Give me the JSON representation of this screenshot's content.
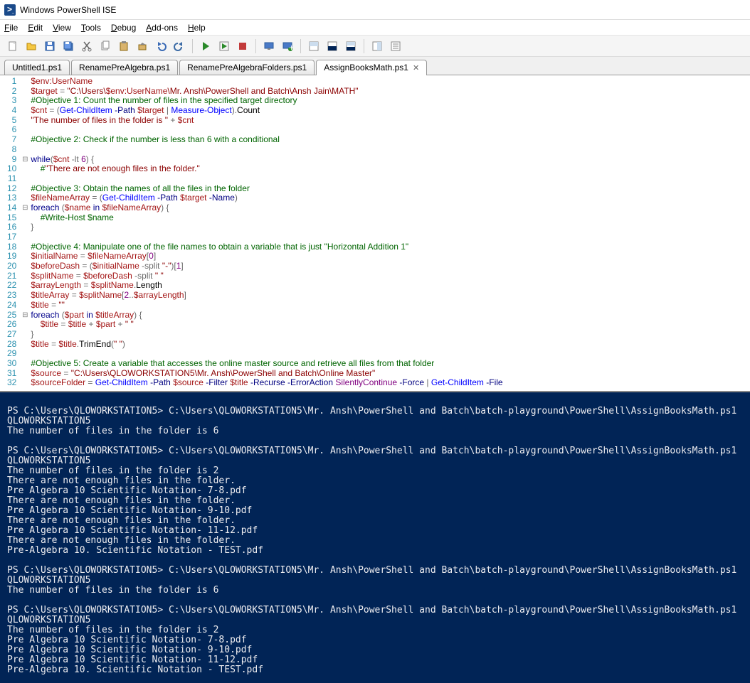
{
  "window": {
    "title": "Windows PowerShell ISE"
  },
  "menu": {
    "file": "File",
    "edit": "Edit",
    "view": "View",
    "tools": "Tools",
    "debug": "Debug",
    "addons": "Add-ons",
    "help": "Help"
  },
  "tabs": [
    {
      "label": "Untitled1.ps1",
      "active": false
    },
    {
      "label": "RenamePreAlgebra.ps1",
      "active": false
    },
    {
      "label": "RenamePreAlgebraFolders.ps1",
      "active": false
    },
    {
      "label": "AssignBooksMath.ps1",
      "active": true
    }
  ],
  "code": {
    "lines": [
      {
        "n": 1,
        "f": "",
        "h": "<span class='c-var'>$env:UserName</span>"
      },
      {
        "n": 2,
        "f": "",
        "h": "<span class='c-var'>$target</span> <span class='c-op'>=</span> <span class='c-str'>\"C:\\Users\\</span><span class='c-var'>$env:UserName</span><span class='c-str'>\\Mr. Ansh\\PowerShell and Batch\\Ansh Jain\\MATH\"</span>"
      },
      {
        "n": 3,
        "f": "",
        "h": "<span class='c-cmt'>#Objective 1: Count the number of files in the specified target directory</span>"
      },
      {
        "n": 4,
        "f": "",
        "h": "<span class='c-var'>$cnt</span> <span class='c-op'>=</span> <span class='c-op'>(</span><span class='c-cmd'>Get-ChildItem</span> <span class='c-param'>-Path</span> <span class='c-var'>$target</span> <span class='c-op'>|</span> <span class='c-cmd'>Measure-Object</span><span class='c-op'>).</span><span class='c-txt'>Count</span>"
      },
      {
        "n": 5,
        "f": "",
        "h": "<span class='c-str'>\"The number of files in the folder is \"</span> <span class='c-op'>+</span> <span class='c-var'>$cnt</span>"
      },
      {
        "n": 6,
        "f": "",
        "h": ""
      },
      {
        "n": 7,
        "f": "",
        "h": "<span class='c-cmt'>#Objective 2: Check if the number is less than 6 with a conditional</span>"
      },
      {
        "n": 8,
        "f": "",
        "h": ""
      },
      {
        "n": 9,
        "f": "⊟",
        "h": "<span class='c-kw'>while</span><span class='c-op'>(</span><span class='c-var'>$cnt</span> <span class='c-op'>-lt</span> <span class='c-num'>6</span><span class='c-op'>) {</span>"
      },
      {
        "n": 10,
        "f": "",
        "h": "    <span class='c-cmt'>#</span><span class='c-str'>\"There are not enough files in the folder.\"</span>"
      },
      {
        "n": 11,
        "f": "",
        "h": ""
      },
      {
        "n": 12,
        "f": "",
        "h": "<span class='c-cmt'>#Objective 3: Obtain the names of all the files in the folder</span>"
      },
      {
        "n": 13,
        "f": "",
        "h": "<span class='c-var'>$fileNameArray</span> <span class='c-op'>= (</span><span class='c-cmd'>Get-ChildItem</span> <span class='c-param'>-Path</span> <span class='c-var'>$target</span> <span class='c-param'>-Name</span><span class='c-op'>)</span>"
      },
      {
        "n": 14,
        "f": "⊟",
        "h": "<span class='c-kw'>foreach</span> <span class='c-op'>(</span><span class='c-var'>$name</span> <span class='c-kw'>in</span> <span class='c-var'>$fileNameArray</span><span class='c-op'>) {</span>"
      },
      {
        "n": 15,
        "f": "",
        "h": "    <span class='c-cmt'>#Write-Host $name</span>"
      },
      {
        "n": 16,
        "f": "",
        "h": "<span class='c-op'>}</span>"
      },
      {
        "n": 17,
        "f": "",
        "h": ""
      },
      {
        "n": 18,
        "f": "",
        "h": "<span class='c-cmt'>#Objective 4: Manipulate one of the file names to obtain a variable that is just \"Horizontal Addition 1\"</span>"
      },
      {
        "n": 19,
        "f": "",
        "h": "<span class='c-var'>$initialName</span> <span class='c-op'>=</span> <span class='c-var'>$fileNameArray</span><span class='c-op'>[</span><span class='c-num'>0</span><span class='c-op'>]</span>"
      },
      {
        "n": 20,
        "f": "",
        "h": "<span class='c-var'>$beforeDash</span> <span class='c-op'>= (</span><span class='c-var'>$initialName</span> <span class='c-op'>-split</span> <span class='c-str'>\"-\"</span><span class='c-op'>)[</span><span class='c-num'>1</span><span class='c-op'>]</span>"
      },
      {
        "n": 21,
        "f": "",
        "h": "<span class='c-var'>$splitName</span> <span class='c-op'>=</span> <span class='c-var'>$beforeDash</span> <span class='c-op'>-split</span> <span class='c-str'>\" \"</span>"
      },
      {
        "n": 22,
        "f": "",
        "h": "<span class='c-var'>$arrayLength</span> <span class='c-op'>=</span> <span class='c-var'>$splitName</span><span class='c-op'>.</span><span class='c-txt'>Length</span>"
      },
      {
        "n": 23,
        "f": "",
        "h": "<span class='c-var'>$titleArray</span> <span class='c-op'>=</span> <span class='c-var'>$splitName</span><span class='c-op'>[</span><span class='c-num'>2</span><span class='c-op'>..</span><span class='c-var'>$arrayLength</span><span class='c-op'>]</span>"
      },
      {
        "n": 24,
        "f": "",
        "h": "<span class='c-var'>$title</span> <span class='c-op'>=</span> <span class='c-str'>\"\"</span>"
      },
      {
        "n": 25,
        "f": "⊟",
        "h": "<span class='c-kw'>foreach</span> <span class='c-op'>(</span><span class='c-var'>$part</span> <span class='c-kw'>in</span> <span class='c-var'>$titleArray</span><span class='c-op'>) {</span>"
      },
      {
        "n": 26,
        "f": "",
        "h": "    <span class='c-var'>$title</span> <span class='c-op'>=</span> <span class='c-var'>$title</span> <span class='c-op'>+</span> <span class='c-var'>$part</span> <span class='c-op'>+</span> <span class='c-str'>\" \"</span>"
      },
      {
        "n": 27,
        "f": "",
        "h": "<span class='c-op'>}</span>"
      },
      {
        "n": 28,
        "f": "",
        "h": "<span class='c-var'>$title</span> <span class='c-op'>=</span> <span class='c-var'>$title</span><span class='c-op'>.</span><span class='c-txt'>TrimEnd</span><span class='c-op'>(</span><span class='c-str'>\" \"</span><span class='c-op'>)</span>"
      },
      {
        "n": 29,
        "f": "",
        "h": ""
      },
      {
        "n": 30,
        "f": "",
        "h": "<span class='c-cmt'>#Objective 5: Create a variable that accesses the online master source and retrieve all files from that folder</span>"
      },
      {
        "n": 31,
        "f": "",
        "h": "<span class='c-var'>$source</span> <span class='c-op'>=</span> <span class='c-str'>\"C:\\Users\\QLOWORKSTATION5\\Mr. Ansh\\PowerShell and Batch\\Online Master\"</span>"
      },
      {
        "n": 32,
        "f": "",
        "h": "<span class='c-var'>$sourceFolder</span> <span class='c-op'>=</span> <span class='c-cmd'>Get-ChildItem</span> <span class='c-param'>-Path</span> <span class='c-var'>$source</span> <span class='c-param'>-Filter</span> <span class='c-var'>$title</span> <span class='c-param'>-Recurse</span> <span class='c-param'>-ErrorAction</span> <span class='c-num'>SilentlyContinue</span> <span class='c-param'>-Force</span> <span class='c-op'>|</span> <span class='c-cmd'>Get-ChildItem</span> <span class='c-param'>-File</span>"
      }
    ]
  },
  "console_lines": [
    "",
    "PS C:\\Users\\QLOWORKSTATION5> C:\\Users\\QLOWORKSTATION5\\Mr. Ansh\\PowerShell and Batch\\batch-playground\\PowerShell\\AssignBooksMath.ps1",
    "QLOWORKSTATION5",
    "The number of files in the folder is 6",
    "",
    "PS C:\\Users\\QLOWORKSTATION5> C:\\Users\\QLOWORKSTATION5\\Mr. Ansh\\PowerShell and Batch\\batch-playground\\PowerShell\\AssignBooksMath.ps1",
    "QLOWORKSTATION5",
    "The number of files in the folder is 2",
    "There are not enough files in the folder.",
    "Pre Algebra 10 Scientific Notation- 7-8.pdf",
    "There are not enough files in the folder.",
    "Pre Algebra 10 Scientific Notation- 9-10.pdf",
    "There are not enough files in the folder.",
    "Pre Algebra 10 Scientific Notation- 11-12.pdf",
    "There are not enough files in the folder.",
    "Pre-Algebra 10. Scientific Notation - TEST.pdf",
    "",
    "PS C:\\Users\\QLOWORKSTATION5> C:\\Users\\QLOWORKSTATION5\\Mr. Ansh\\PowerShell and Batch\\batch-playground\\PowerShell\\AssignBooksMath.ps1",
    "QLOWORKSTATION5",
    "The number of files in the folder is 6",
    "",
    "PS C:\\Users\\QLOWORKSTATION5> C:\\Users\\QLOWORKSTATION5\\Mr. Ansh\\PowerShell and Batch\\batch-playground\\PowerShell\\AssignBooksMath.ps1",
    "QLOWORKSTATION5",
    "The number of files in the folder is 2",
    "Pre Algebra 10 Scientific Notation- 7-8.pdf",
    "Pre Algebra 10 Scientific Notation- 9-10.pdf",
    "Pre Algebra 10 Scientific Notation- 11-12.pdf",
    "Pre-Algebra 10. Scientific Notation - TEST.pdf"
  ],
  "toolbar_icons": [
    "new-file",
    "open-file",
    "save",
    "save-all",
    "cut",
    "copy",
    "paste",
    "clear",
    "undo",
    "redo",
    "sep",
    "run-script",
    "run-selection",
    "stop",
    "sep",
    "remote",
    "new-remote",
    "sep",
    "show-script",
    "show-console",
    "show-both",
    "sep",
    "show-command",
    "show-commands"
  ]
}
